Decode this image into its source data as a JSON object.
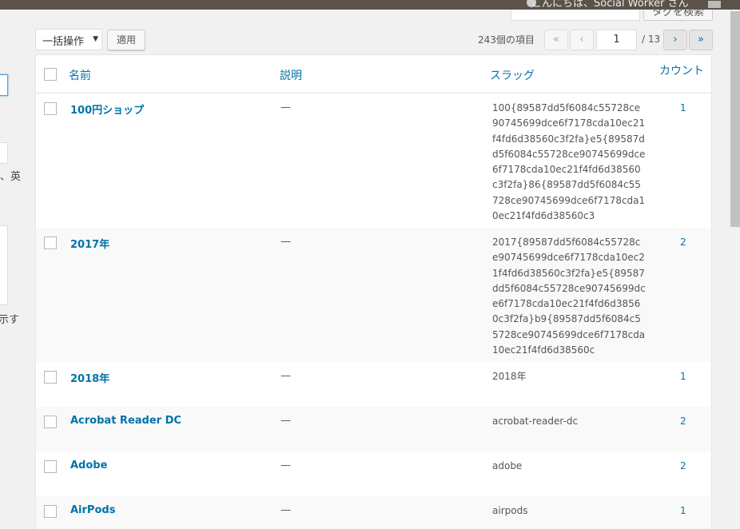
{
  "adminbar": {
    "greeting": "こんにちは、Social Worker さん"
  },
  "search": {
    "button_label": "タグを検索"
  },
  "left_panel": {
    "text_a": "、英",
    "text_b": "示す"
  },
  "tablenav": {
    "bulk_label": "一括操作",
    "apply_label": "適用",
    "items_count": "243個の項目",
    "first_label": "«",
    "prev_label": "‹",
    "current_page": "1",
    "total_pages": "/ 13",
    "next_label": "›",
    "last_label": "»"
  },
  "table": {
    "headers": {
      "name": "名前",
      "description": "説明",
      "slug": "スラッグ",
      "count": "カウント"
    },
    "rows": [
      {
        "name": "100円ショップ",
        "description": "—",
        "slug": "100{89587dd5f6084c55728ce90745699dce6f7178cda10ec21f4fd6d38560c3f2fa}e5{89587dd5f6084c55728ce90745699dce6f7178cda10ec21f4fd6d38560c3f2fa}86{89587dd5f6084c55728ce90745699dce6f7178cda10ec21f4fd6d38560c3",
        "count": "1"
      },
      {
        "name": "2017年",
        "description": "—",
        "slug": "2017{89587dd5f6084c55728ce90745699dce6f7178cda10ec21f4fd6d38560c3f2fa}e5{89587dd5f6084c55728ce90745699dce6f7178cda10ec21f4fd6d38560c3f2fa}b9{89587dd5f6084c55728ce90745699dce6f7178cda10ec21f4fd6d38560c",
        "count": "2"
      },
      {
        "name": "2018年",
        "description": "—",
        "slug": "2018年",
        "count": "1"
      },
      {
        "name": "Acrobat Reader DC",
        "description": "—",
        "slug": "acrobat-reader-dc",
        "count": "2"
      },
      {
        "name": "Adobe",
        "description": "—",
        "slug": "adobe",
        "count": "2"
      },
      {
        "name": "AirPods",
        "description": "—",
        "slug": "airpods",
        "count": "1"
      }
    ]
  }
}
